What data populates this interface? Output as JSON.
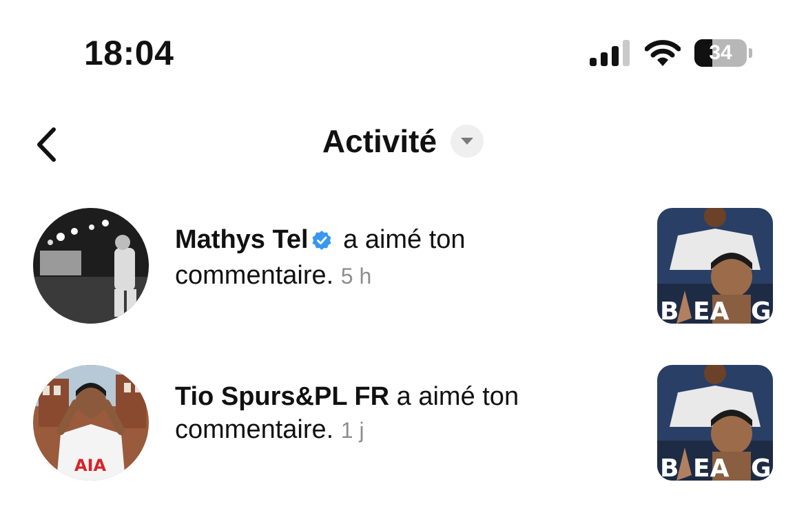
{
  "status_bar": {
    "time": "18:04",
    "battery_level": "34",
    "battery_fraction": 0.34,
    "signal_bars": 3,
    "signal_bars_total": 4
  },
  "header": {
    "title": "Activité"
  },
  "activity": [
    {
      "username": "Mathys Tel",
      "verified": true,
      "action": "a aimé ton commentaire.",
      "time": "5 h"
    },
    {
      "username": "Tio Spurs&PL FR",
      "verified": false,
      "action": "a aimé ton commentaire.",
      "time": "1 j"
    }
  ],
  "icons": {
    "back": "chevron-left-icon",
    "dropdown": "caret-down-icon",
    "verified": "verified-badge-icon",
    "wifi": "wifi-icon",
    "signal": "cellular-signal-icon",
    "battery": "battery-icon"
  },
  "colors": {
    "verified": "#3897f0",
    "muted_text": "#8e8e8e",
    "dropdown_bg": "#efefef"
  }
}
